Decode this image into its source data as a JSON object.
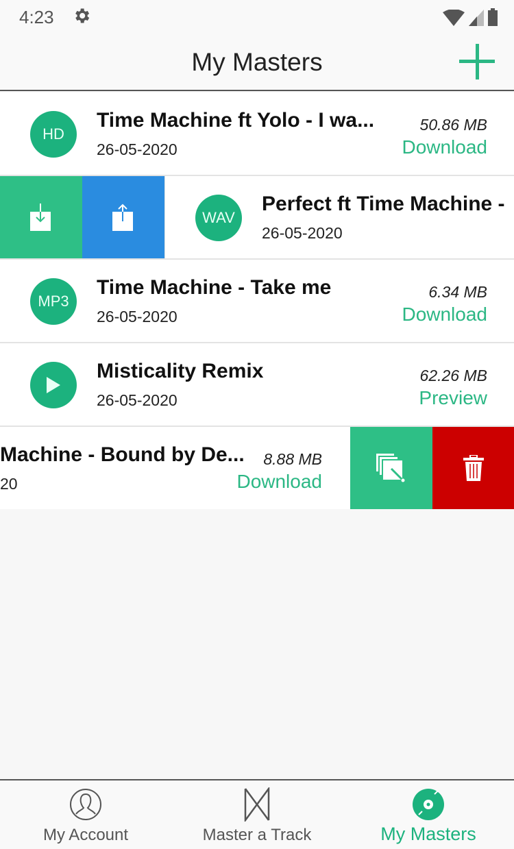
{
  "status_bar": {
    "time": "4:23",
    "icons": [
      "gear-icon",
      "wifi-icon",
      "signal-icon",
      "battery-icon"
    ]
  },
  "header": {
    "title": "My Masters",
    "add_icon": "plus-icon"
  },
  "colors": {
    "accent": "#1cb27e",
    "swipe_green": "#2ebf86",
    "swipe_blue": "#2a8ce0",
    "swipe_red": "#cc0000"
  },
  "tracks": [
    {
      "badge": "HD",
      "title": "Time Machine ft Yolo - I wa...",
      "date": "26-05-2020",
      "size": "50.86 MB",
      "action": "Download"
    },
    {
      "badge": "WAV",
      "title": "Perfect ft Time Machine -",
      "date": "26-05-2020",
      "size": "",
      "action": "",
      "swipe_actions": [
        "download-icon",
        "share-icon"
      ]
    },
    {
      "badge": "MP3",
      "title": "Time Machine - Take me",
      "date": "26-05-2020",
      "size": "6.34 MB",
      "action": "Download"
    },
    {
      "badge": "play-icon",
      "title": "Misticality Remix",
      "date": "26-05-2020",
      "size": "62.26 MB",
      "action": "Preview"
    },
    {
      "badge": "",
      "title": "Machine - Bound by De...",
      "date": "20",
      "size": "8.88 MB",
      "action": "Download",
      "swipe_actions": [
        "copy-edit-icon",
        "trash-icon"
      ]
    }
  ],
  "bottom_nav": [
    {
      "label": "My Account",
      "icon": "user-icon",
      "active": false
    },
    {
      "label": "Master a Track",
      "icon": "master-logo-icon",
      "active": false
    },
    {
      "label": "My Masters",
      "icon": "disc-icon",
      "active": true
    }
  ]
}
